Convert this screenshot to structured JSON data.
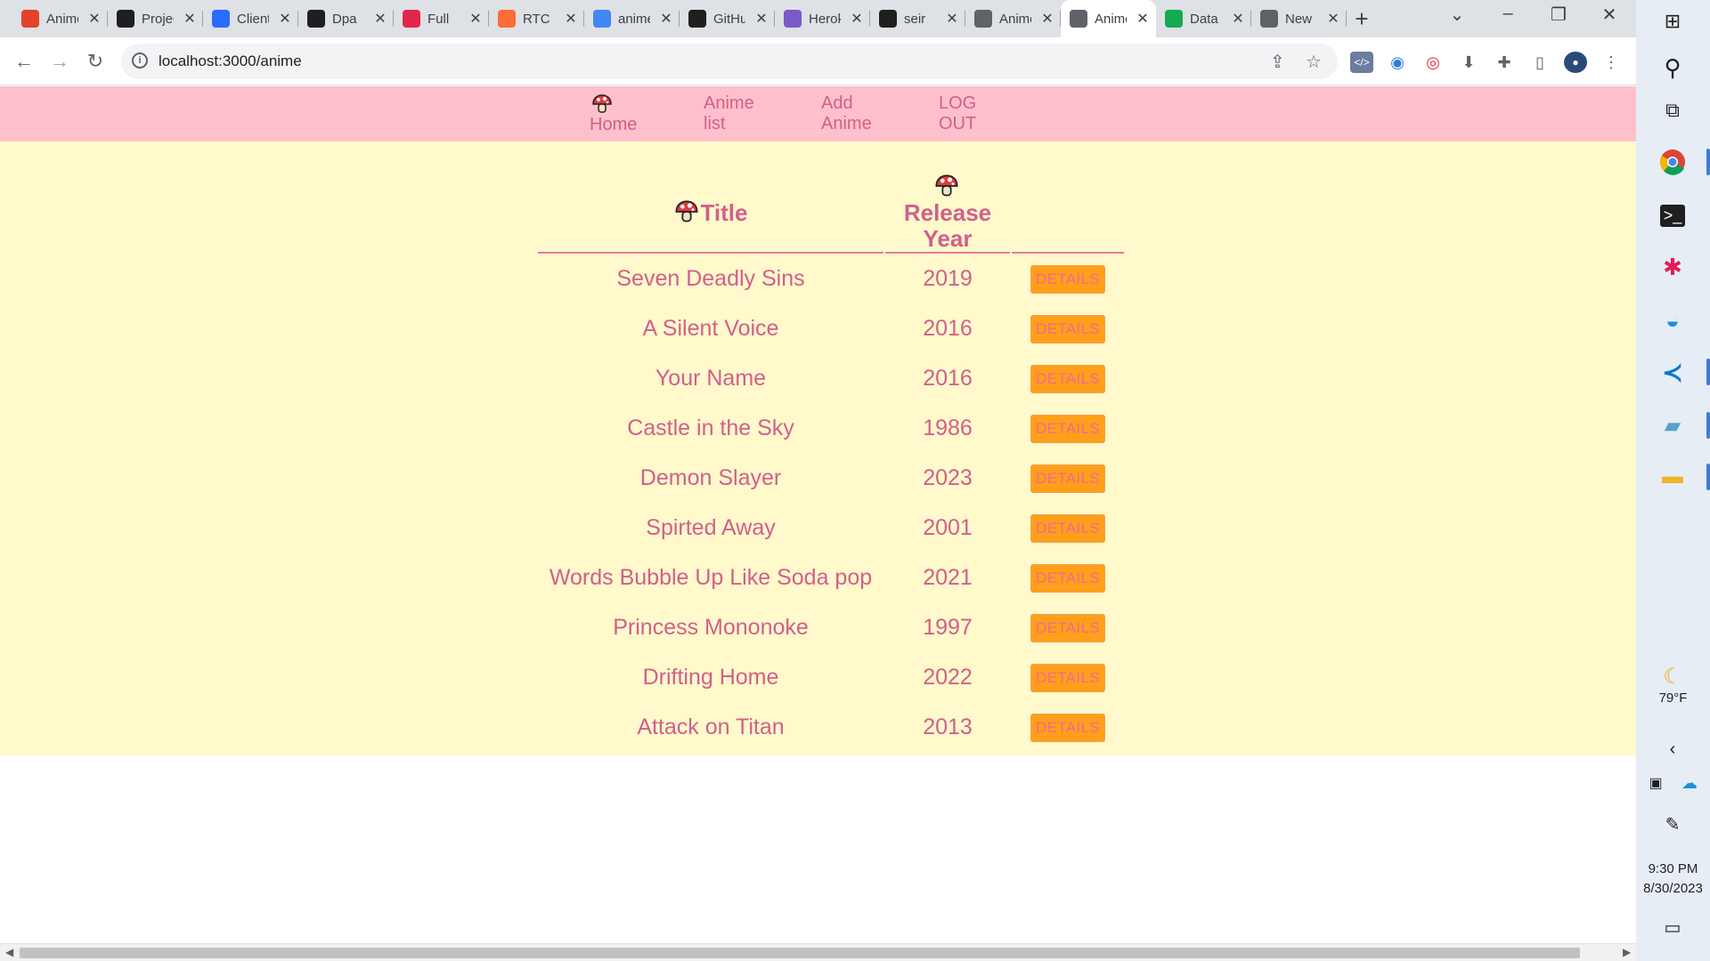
{
  "browser": {
    "tabs": [
      {
        "title": "Anime",
        "icon": "gitlab-icon",
        "color": "#e2432a"
      },
      {
        "title": "Project",
        "icon": "trello-icon",
        "color": "#1f1f1f"
      },
      {
        "title": "Client",
        "icon": "api-icon",
        "color": "#2b6cff"
      },
      {
        "title": "Dpa",
        "icon": "github-icon",
        "color": "#1f1f1f"
      },
      {
        "title": "Full",
        "icon": "ga-icon",
        "color": "#e0274b"
      },
      {
        "title": "RTC",
        "icon": "postman-icon",
        "color": "#ff6c37"
      },
      {
        "title": "anime",
        "icon": "google-icon",
        "color": "#4285f4"
      },
      {
        "title": "GitHub",
        "icon": "github-icon",
        "color": "#1f1f1f"
      },
      {
        "title": "Heroku",
        "icon": "heroku-icon",
        "color": "#7a5ac8"
      },
      {
        "title": "seir",
        "icon": "github-icon",
        "color": "#1f1f1f"
      },
      {
        "title": "Anime",
        "icon": "globe-icon",
        "color": "#5f6368"
      },
      {
        "title": "Anime",
        "icon": "globe-icon",
        "color": "#5f6368",
        "active": true
      },
      {
        "title": "Data",
        "icon": "mongodb-icon",
        "color": "#13aa52"
      },
      {
        "title": "New",
        "icon": "globe-icon",
        "color": "#5f6368"
      }
    ],
    "url": "localhost:3000/anime"
  },
  "nav": {
    "home": "Home",
    "anime_list": "Anime list",
    "add_anime": "Add Anime",
    "logout": "LOG OUT"
  },
  "table": {
    "headers": {
      "title": "Title",
      "year": "Release Year"
    },
    "details_label": "DETAILS",
    "rows": [
      {
        "title": "Seven Deadly Sins",
        "year": "2019"
      },
      {
        "title": "A Silent Voice",
        "year": "2016"
      },
      {
        "title": "Your Name",
        "year": "2016"
      },
      {
        "title": "Castle in the Sky",
        "year": "1986"
      },
      {
        "title": "Demon Slayer",
        "year": "2023"
      },
      {
        "title": "Spirted Away",
        "year": "2001"
      },
      {
        "title": "Words Bubble Up Like Soda pop",
        "year": "2021"
      },
      {
        "title": "Princess Mononoke",
        "year": "1997"
      },
      {
        "title": "Drifting Home",
        "year": "2022"
      },
      {
        "title": "Attack on Titan",
        "year": "2013"
      }
    ]
  },
  "taskbar": {
    "weather": "79°F",
    "time": "9:30 PM",
    "date": "8/30/2023"
  },
  "colors": {
    "nav_bg": "#ffc0cb",
    "content_bg": "#fff9cc",
    "text_pink": "#d1608a",
    "button_orange": "#ff9f1a"
  }
}
